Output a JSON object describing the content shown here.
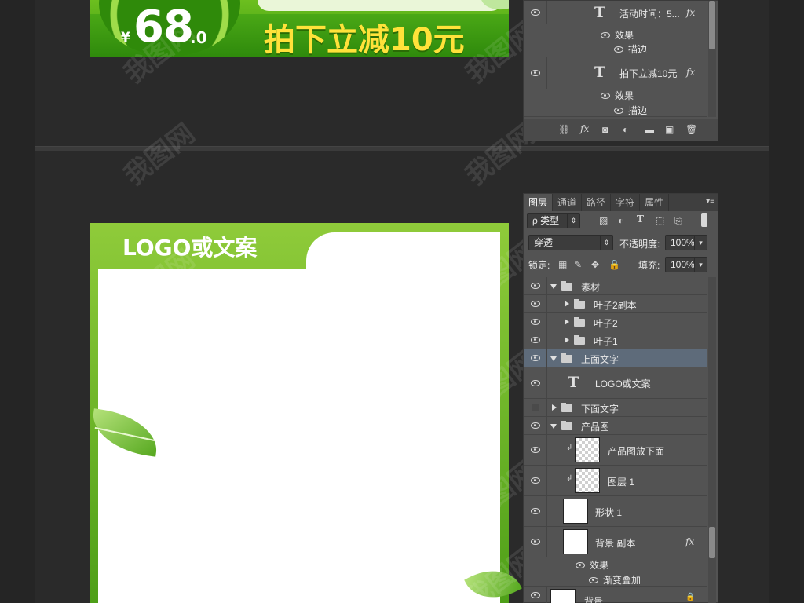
{
  "banner": {
    "currency": "¥",
    "price_int": "68",
    "price_dec": ".0",
    "slogan": "拍下立减10元"
  },
  "card": {
    "logo_text": "LOGO或文案"
  },
  "watermark": {
    "text": "我图网"
  },
  "panel_top": {
    "rows": [
      {
        "name": "活动时间：5...",
        "fx": "fx",
        "effects_label": "效果",
        "effect": "描边"
      },
      {
        "name": "拍下立减10元",
        "fx": "fx",
        "effects_label": "效果",
        "effect": "描边"
      }
    ],
    "bottom_icons": [
      "link-icon",
      "fx-icon",
      "mask-icon",
      "adjustment-icon",
      "group-icon",
      "new-layer-icon",
      "delete-icon"
    ]
  },
  "panel_main": {
    "tabs": [
      "图层",
      "通道",
      "路径",
      "字符",
      "属性"
    ],
    "filter_label": "ρ 类型",
    "blend_mode": "穿透",
    "opacity_label": "不透明度:",
    "opacity_value": "100%",
    "lock_label": "锁定:",
    "fill_label": "填充:",
    "fill_value": "100%",
    "layers": {
      "sucai": "素材",
      "yezi2fb": "叶子2副本",
      "yezi2": "叶子2",
      "yezi1": "叶子1",
      "top_text": "上面文字",
      "logo_text": "LOGO或文案",
      "bottom_text": "下面文字",
      "product_group": "产品图",
      "product_place": "产品图放下面",
      "layer1": "图层 1",
      "shape1": "形状 1",
      "bg_copy": "背景 副本",
      "bg_copy_fx": "fx",
      "effects_label": "效果",
      "gradient_overlay": "渐变叠加",
      "background": "背景"
    }
  }
}
